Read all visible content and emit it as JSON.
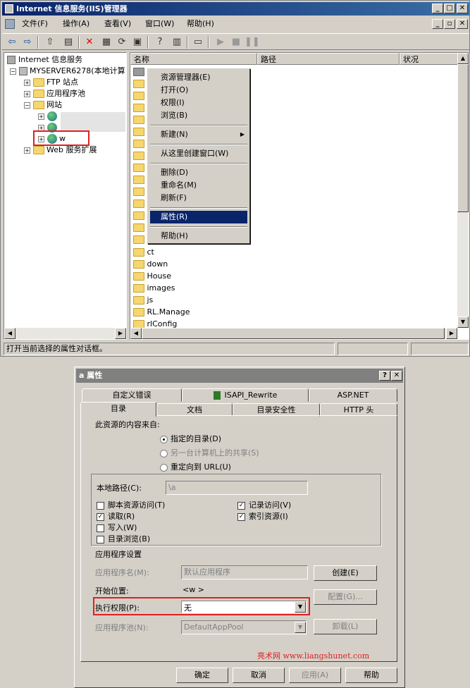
{
  "app": {
    "title": "Internet 信息服务(IIS)管理器"
  },
  "menu": [
    "文件(F)",
    "操作(A)",
    "查看(V)",
    "窗口(W)",
    "帮助(H)"
  ],
  "tree": {
    "root": "Internet 信息服务",
    "server": "MYSERVER6278(本地计算",
    "ftp": "FTP 站点",
    "apppool": "应用程序池",
    "sites": "网站",
    "site_w": "w",
    "webext": "Web 服务扩展"
  },
  "list": {
    "col_name": "名称",
    "col_path": "路径",
    "col_status": "状况",
    "rows": [
      "ct",
      "down",
      "House",
      "images",
      "js",
      "RL.Manage",
      "rlConfig"
    ]
  },
  "context_menu": {
    "explore": "资源管理器(E)",
    "open": "打开(O)",
    "perms": "权限(I)",
    "browse": "浏览(B)",
    "new": "新建(N)",
    "newwin": "从这里创建窗口(W)",
    "delete": "删除(D)",
    "rename": "重命名(M)",
    "refresh": "刷新(F)",
    "props": "属性(R)",
    "help": "帮助(H)"
  },
  "status": "打开当前选择的属性对话框。",
  "dialog": {
    "title": "a 属性",
    "help_btn": "?",
    "close_btn": "✕",
    "tabs_top": [
      "自定义错误",
      "ISAPI_Rewrite",
      "ASP.NET"
    ],
    "tabs_bottom": [
      "目录",
      "文档",
      "目录安全性",
      "HTTP 头"
    ],
    "source_label": "此资源的内容来自:",
    "radio1": "指定的目录(D)",
    "radio2": "另一台计算机上的共享(S)",
    "radio3": "重定向到 URL(U)",
    "local_path_label": "本地路径(C):",
    "local_path_value": "\\a",
    "chk_script": "脚本资源访问(T)",
    "chk_read": "读取(R)",
    "chk_write": "写入(W)",
    "chk_browse": "目录浏览(B)",
    "chk_log": "记录访问(V)",
    "chk_index": "索引资源(I)",
    "app_settings": "应用程序设置",
    "app_name_label": "应用程序名(M):",
    "app_name_value": "默认应用程序",
    "start_label": "开始位置:",
    "start_value": "<w >",
    "exec_label": "执行权限(P):",
    "exec_value": "无",
    "pool_label": "应用程序池(N):",
    "pool_value": "DefaultAppPool",
    "btn_create": "创建(E)",
    "btn_config": "配置(G)...",
    "btn_unload": "卸载(L)",
    "watermark": "亮术网 www.liangshunet.com",
    "ok": "确定",
    "cancel": "取消",
    "apply": "应用(A)",
    "help": "帮助"
  }
}
